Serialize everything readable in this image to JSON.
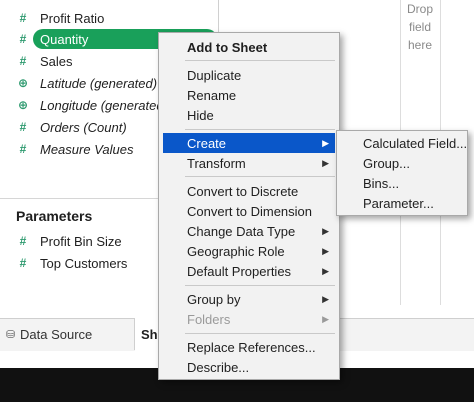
{
  "data_pane": {
    "measures": [
      {
        "label": "Profit Ratio",
        "icon": "measure-hash-icon",
        "italic": false,
        "selected": false
      },
      {
        "label": "Quantity",
        "icon": "measure-hash-icon",
        "italic": false,
        "selected": true
      },
      {
        "label": "Sales",
        "icon": "measure-hash-icon",
        "italic": false,
        "selected": false
      },
      {
        "label": "Latitude (generated)",
        "icon": "globe-icon",
        "italic": true,
        "selected": false
      },
      {
        "label": "Longitude (generated)",
        "icon": "globe-icon",
        "italic": true,
        "selected": false
      },
      {
        "label": "Orders (Count)",
        "icon": "measure-hash-icon",
        "italic": true,
        "selected": false
      },
      {
        "label": "Measure Values",
        "icon": "measure-hash-icon",
        "italic": true,
        "selected": false
      }
    ],
    "parameters_heading": "Parameters",
    "parameters": [
      {
        "label": "Profit Bin Size",
        "icon": "measure-hash-icon"
      },
      {
        "label": "Top Customers",
        "icon": "measure-hash-icon"
      }
    ]
  },
  "drop_field_text": "Drop\nfield\nhere",
  "tabs": {
    "data_source": "Data Source",
    "sheet": "Sh"
  },
  "context_menu": {
    "add_to_sheet": "Add to Sheet",
    "duplicate": "Duplicate",
    "rename": "Rename",
    "hide": "Hide",
    "create": "Create",
    "transform": "Transform",
    "convert_to_discrete": "Convert to Discrete",
    "convert_to_dimension": "Convert to Dimension",
    "change_data_type": "Change Data Type",
    "geographic_role": "Geographic Role",
    "default_properties": "Default Properties",
    "group_by": "Group by",
    "folders": "Folders",
    "replace_references": "Replace References...",
    "describe": "Describe..."
  },
  "create_submenu": {
    "calculated_field": "Calculated Field...",
    "group": "Group...",
    "bins": "Bins...",
    "parameter": "Parameter..."
  },
  "colors": {
    "selected_pill": "#19a05a",
    "menu_highlight": "#0a57c9",
    "field_icon": "#2e9a6f"
  }
}
